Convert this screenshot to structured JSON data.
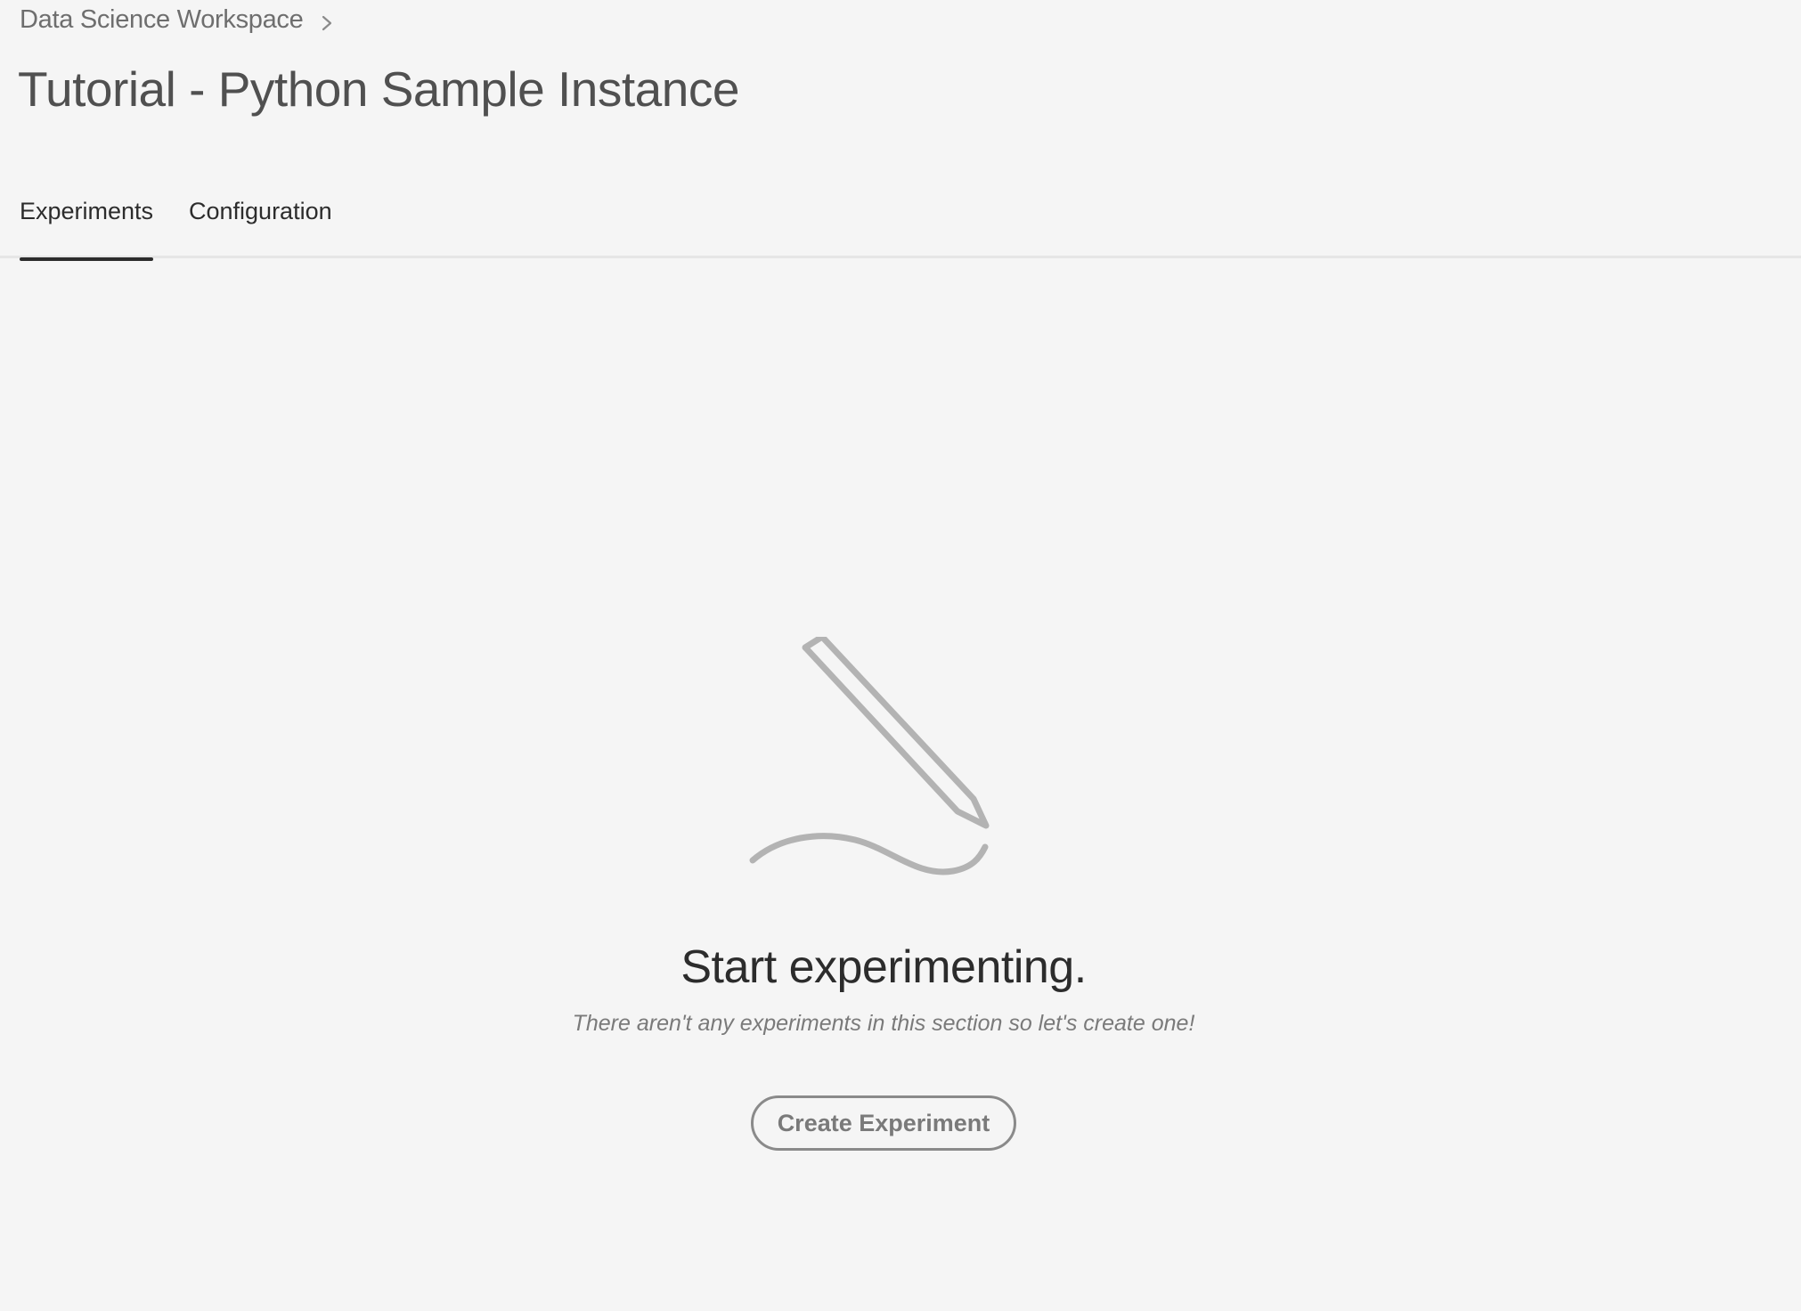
{
  "breadcrumb": {
    "parent_label": "Data Science Workspace"
  },
  "page": {
    "title": "Tutorial - Python Sample Instance"
  },
  "tabs": [
    {
      "label": "Experiments",
      "active": true
    },
    {
      "label": "Configuration",
      "active": false
    }
  ],
  "empty_state": {
    "icon": "pencil-drawing-icon",
    "title": "Start experimenting.",
    "subtitle": "There aren't any experiments in this section so let's create one!",
    "button_label": "Create Experiment"
  },
  "colors": {
    "background": "#f5f5f5",
    "text": "#2c2c2c",
    "muted": "#7a7a7a",
    "illustration": "#b3b3b3"
  }
}
